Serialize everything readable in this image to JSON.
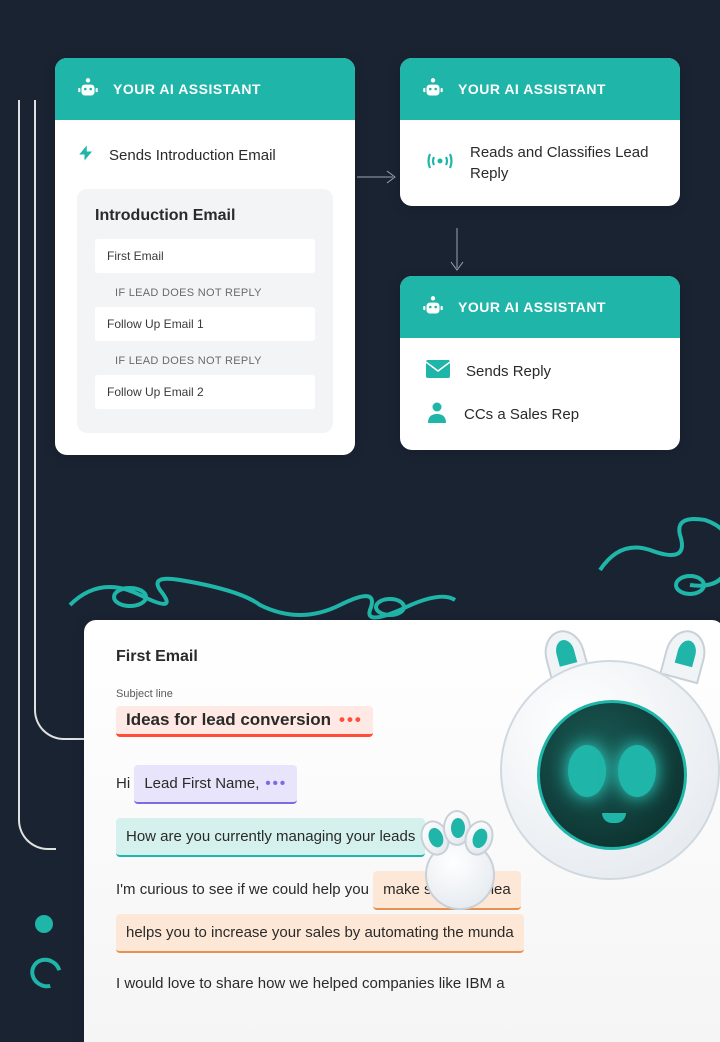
{
  "cards": {
    "card1": {
      "header": "YOUR AI ASSISTANT",
      "action": "Sends Introduction Email",
      "sequence_title": "Introduction Email",
      "items": [
        {
          "type": "email",
          "label": "First Email"
        },
        {
          "type": "condition",
          "label": "IF LEAD DOES NOT REPLY"
        },
        {
          "type": "email",
          "label": "Follow Up Email 1"
        },
        {
          "type": "condition",
          "label": "IF LEAD DOES NOT REPLY"
        },
        {
          "type": "email",
          "label": "Follow Up Email 2"
        }
      ]
    },
    "card2": {
      "header": "YOUR AI ASSISTANT",
      "action": "Reads and Classifies Lead Reply"
    },
    "card3": {
      "header": "YOUR AI ASSISTANT",
      "action1": "Sends Reply",
      "action2": "CCs a Sales Rep"
    }
  },
  "email": {
    "title": "First Email",
    "subject_label": "Subject line",
    "subject": "Ideas for lead conversion",
    "greeting_prefix": "Hi",
    "greeting_tag": "Lead First Name,",
    "line_green": "How are you currently managing your leads",
    "line2_prefix": "I'm curious to see if we could help you",
    "line2_tag": "make sure your lea",
    "line3_tag": "helps you to increase your sales by automating the munda",
    "line4": "I would love to share how we helped companies like IBM a"
  }
}
